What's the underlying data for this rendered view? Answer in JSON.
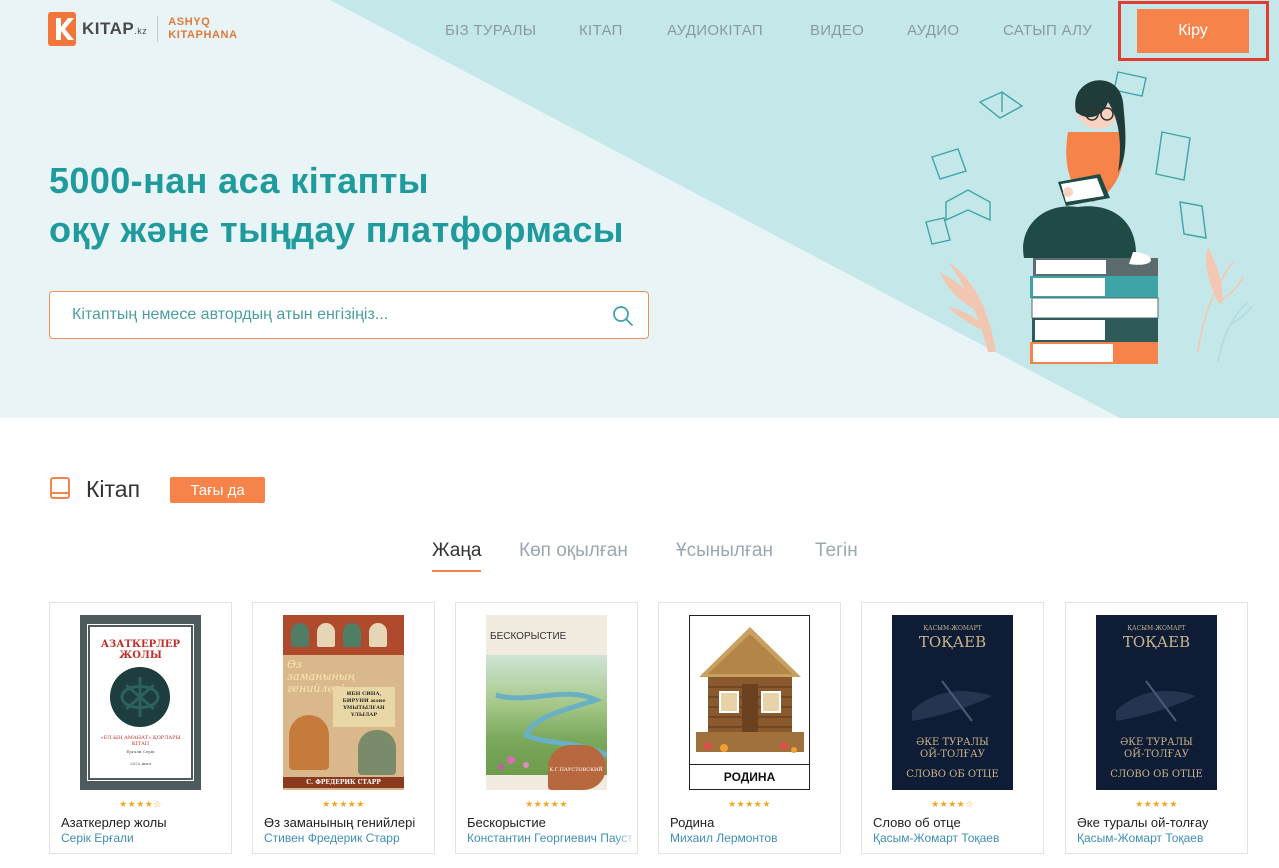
{
  "header": {
    "logo_text": "KITAP",
    "logo_domain": ".kz",
    "logo_sub_line1": "ASHYQ",
    "logo_sub_line2": "KITAPHANA",
    "nav": [
      "БІЗ ТУРАЛЫ",
      "КІТАП",
      "АУДИОКІТАП",
      "ВИДЕО",
      "АУДИО",
      "САТЫП АЛУ"
    ],
    "login_label": "Кіру"
  },
  "hero": {
    "title_line1": "5000-нан аса кітапты",
    "title_line2": "оқу және тыңдау платформасы",
    "search_placeholder": "Кітаптың немесе автордың атын енгізіңіз..."
  },
  "section": {
    "title": "Кітап",
    "more_label": "Тағы да",
    "tabs": [
      "Жаңа",
      "Көп оқылған",
      "Ұсынылған",
      "Тегін"
    ],
    "active_tab": "Жаңа"
  },
  "books": [
    {
      "title": "Азаткерлер жолы",
      "author": "Серік Ерғали",
      "rating": 4,
      "cover_title": "АЗАТКЕРЛЕР ЖОЛЫ",
      "cover_sub": "«ЕЛ-ЫҢ АМАНАТ» ҚОРЛАРЫ КІТАП",
      "cover_author": "Ерғали Серік",
      "cover_year": "2023 жыл"
    },
    {
      "title": "Өз заманының генийлері",
      "author": "Стивен Фредерик Старр",
      "rating": 5,
      "cover_title": "Өз заманының генийлері",
      "cover_sub": "ИБН СИНА, БИРУНИ және ҰМЫТЫЛҒАН ҰЛЫЛАР",
      "cover_author": "С. ФРЕДЕРИК СТАРР"
    },
    {
      "title": "Бескорыстие",
      "author": "Константин Георгиевич Паустовский",
      "rating": 5,
      "cover_title": "БЕСКОРЫСТИЕ",
      "cover_author": "К.Г.ПАУСТОВСКИЙ"
    },
    {
      "title": "Родина",
      "author": "Михаил Лермонтов",
      "rating": 5,
      "cover_title": "РОДИНА"
    },
    {
      "title": "Слово об отце",
      "author": "Қасым-Жомарт Тоқаев",
      "rating": 4,
      "cover_author_top": "ҚАСЫМ-ЖОМАРТ",
      "cover_name": "ТОҚАЕВ",
      "cover_t1": "ӘКЕ ТУРАЛЫ",
      "cover_t2": "ОЙ-ТОЛҒАУ",
      "cover_t3": "СЛОВО ОБ ОТЦЕ"
    },
    {
      "title": "Әке туралы ой-толғау",
      "author": "Қасым-Жомарт Тоқаев",
      "rating": 5,
      "cover_author_top": "ҚАСЫМ-ЖОМАРТ",
      "cover_name": "ТОҚАЕВ",
      "cover_t1": "ӘКЕ ТУРАЛЫ",
      "cover_t2": "ОЙ-ТОЛҒАУ",
      "cover_t3": "СЛОВО ОБ ОТЦЕ"
    }
  ],
  "colors": {
    "accent": "#f6844a",
    "teal": "#1f9a9d",
    "hero_bg": "#e9f4f6",
    "hero_triangle": "#c4e8ea",
    "highlight_border": "#e23b30"
  }
}
